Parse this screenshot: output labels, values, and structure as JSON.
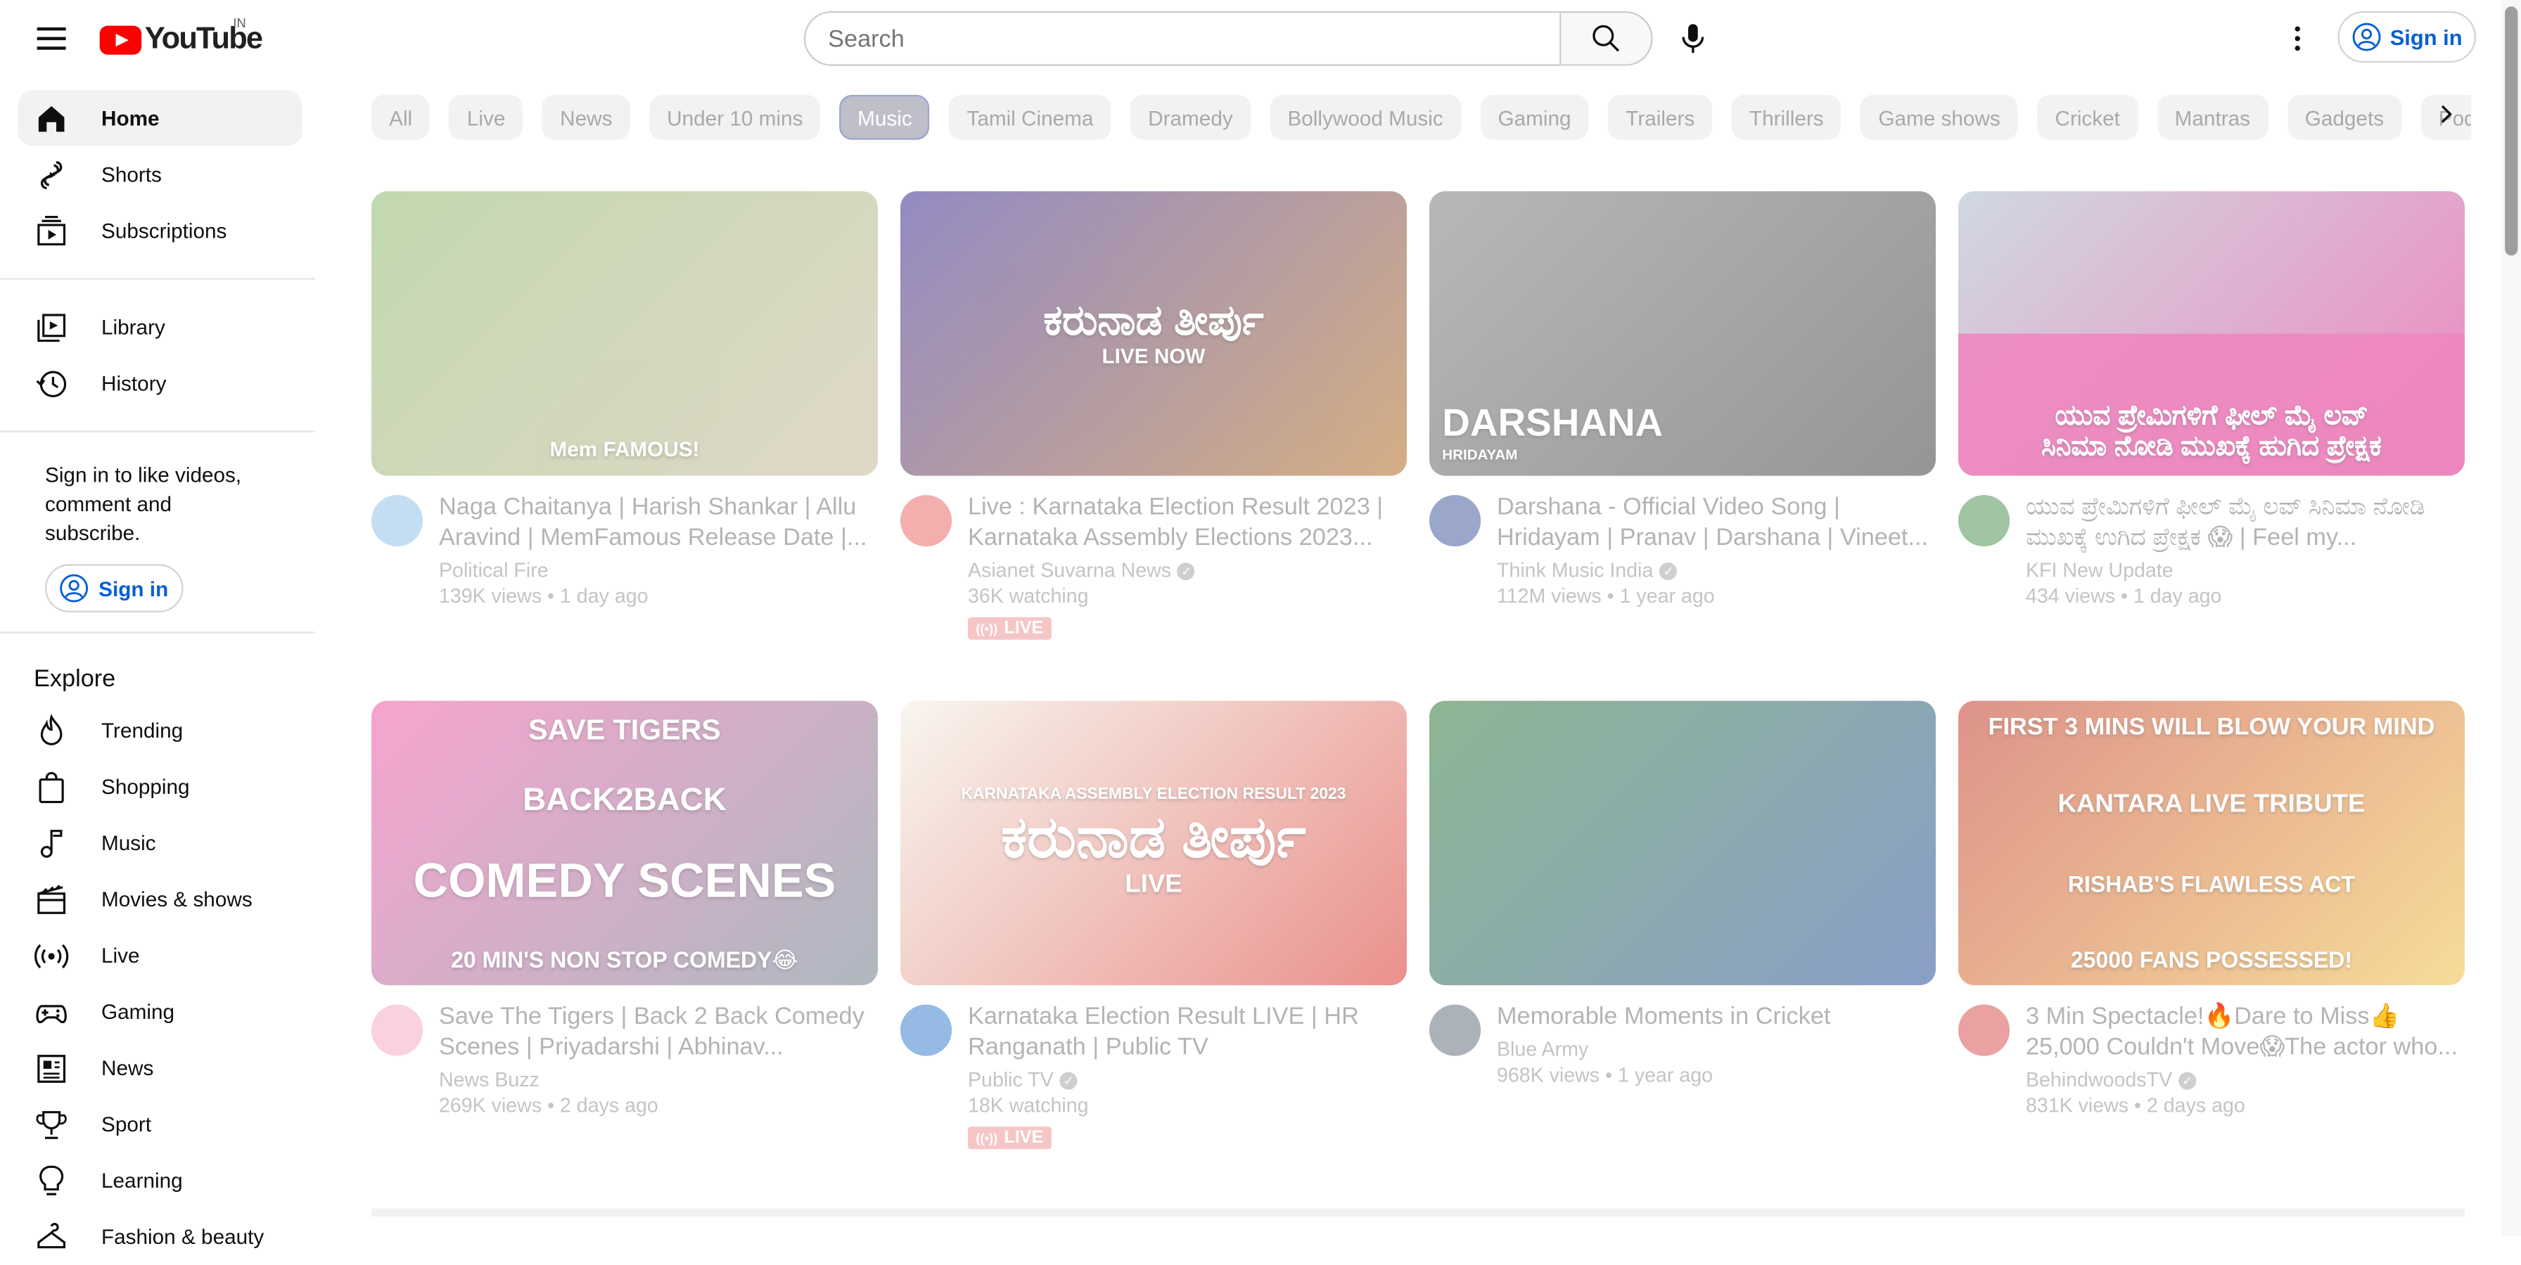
{
  "header": {
    "logo_text": "YouTube",
    "region": "IN",
    "search_placeholder": "Search",
    "signin_label": "Sign in"
  },
  "sidebar": {
    "primary": [
      {
        "label": "Home",
        "icon": "home-icon",
        "active": true
      },
      {
        "label": "Shorts",
        "icon": "shorts-icon"
      },
      {
        "label": "Subscriptions",
        "icon": "subscriptions-icon"
      }
    ],
    "secondary": [
      {
        "label": "Library",
        "icon": "library-icon"
      },
      {
        "label": "History",
        "icon": "history-icon"
      }
    ],
    "signin_prompt": "Sign in to like videos, comment and subscribe.",
    "signin_label": "Sign in",
    "explore_heading": "Explore",
    "explore": [
      {
        "label": "Trending",
        "icon": "trending-icon"
      },
      {
        "label": "Shopping",
        "icon": "shopping-icon"
      },
      {
        "label": "Music",
        "icon": "music-icon"
      },
      {
        "label": "Movies & shows",
        "icon": "movies-icon"
      },
      {
        "label": "Live",
        "icon": "live-icon"
      },
      {
        "label": "Gaming",
        "icon": "gaming-icon"
      },
      {
        "label": "News",
        "icon": "news-icon"
      },
      {
        "label": "Sport",
        "icon": "sport-icon"
      },
      {
        "label": "Learning",
        "icon": "learning-icon"
      },
      {
        "label": "Fashion & beauty",
        "icon": "fashion-icon"
      }
    ]
  },
  "chips": [
    "All",
    "Live",
    "News",
    "Under 10 mins",
    "Music",
    "Tamil Cinema",
    "Dramedy",
    "Bollywood Music",
    "Gaming",
    "Trailers",
    "Thrillers",
    "Game shows",
    "Cricket",
    "Mantras",
    "Gadgets",
    "Podcasts"
  ],
  "active_chip": "Music",
  "videos": [
    {
      "title": "Naga Chaitanya | Harish Shankar | Allu Aravind | MemFamous Release Date |...",
      "channel": "Political Fire",
      "verified": false,
      "stats": "139K views • 1 day ago",
      "live": false,
      "thumb_colors": [
        "#8fb86e",
        "#c7b79a"
      ],
      "avatar_color": "#7fb4e0"
    },
    {
      "title": "Live : Karnataka Election Result 2023 | Karnataka Assembly Elections 2023...",
      "channel": "Asianet Suvarna News",
      "verified": true,
      "stats": "36K watching",
      "live": true,
      "live_label": "LIVE",
      "thumb_colors": [
        "#3b2a8f",
        "#b06b1f"
      ],
      "avatar_color": "#e64b4b"
    },
    {
      "title": "Darshana - Official Video Song | Hridayam | Pranav | Darshana | Vineet...",
      "channel": "Think Music India",
      "verified": true,
      "stats": "112M views • 1 year ago",
      "live": false,
      "thumb_colors": [
        "#7d7d7d",
        "#3e3e3e"
      ],
      "avatar_color": "#1f3a8a"
    },
    {
      "title": "ಯುವ ಪ್ರೇಮಿಗಳಿಗೆ ಫೀಲ್ ಮೈ ಲವ್ ಸಿನಿಮಾ ನೋಡಿ ಮುಖಕ್ಕೆ ಉಗಿದ ಪ್ರೇಕ್ಷಕ 😱 | Feel my...",
      "channel": "KFI New Update",
      "verified": false,
      "stats": "434 views • 1 day ago",
      "live": false,
      "thumb_colors": [
        "#a9b9c8",
        "#e0258a"
      ],
      "avatar_color": "#2e7d32"
    },
    {
      "title": "Save The Tigers | Back 2 Back Comedy Scenes | Priyadarshi | Abhinav...",
      "channel": "News Buzz",
      "verified": false,
      "stats": "269K views • 2 days ago",
      "live": false,
      "thumb_colors": [
        "#f05aa8",
        "#6b7f8c"
      ],
      "avatar_color": "#f29bb5"
    },
    {
      "title": "Karnataka Election Result LIVE | HR Ranganath | Public TV",
      "channel": "Public TV",
      "verified": true,
      "stats": "18K watching",
      "live": true,
      "live_label": "LIVE",
      "thumb_colors": [
        "#f2efe2",
        "#d9362f"
      ],
      "avatar_color": "#1565c0"
    },
    {
      "title": "Memorable Moments in Cricket",
      "channel": "Blue Army",
      "verified": false,
      "stats": "968K views • 1 year ago",
      "live": false,
      "thumb_colors": [
        "#2f7a3a",
        "#2a4f9a"
      ],
      "avatar_color": "#445566"
    },
    {
      "title": "3 Min Spectacle!🔥Dare to Miss👍 25,000 Couldn't Move😱The actor who...",
      "channel": "BehindwoodsTV",
      "verified": true,
      "stats": "831K views • 2 days ago",
      "live": false,
      "thumb_colors": [
        "#c23a2a",
        "#f0c045"
      ],
      "avatar_color": "#d32f2f"
    }
  ],
  "thumb_texts": [
    [
      "Mem FAMOUS!"
    ],
    [
      "ಕರುನಾಡ ತೀರ್ಪು",
      "LIVE NOW"
    ],
    [
      "DARSHANA",
      "HRIDAYAM"
    ],
    [
      "ಯುವ ಪ್ರೇಮಿಗಳಿಗೆ ಫೀಲ್ ಮೈ ಲವ್",
      "ಸಿನಿಮಾ ನೋಡಿ ಮುಖಕ್ಕೆ ಹುಗಿದ ಪ್ರೇಕ್ಷಕ"
    ],
    [
      "SAVE TIGERS",
      "BACK2BACK",
      "COMEDY SCENES",
      "20 MIN'S NON STOP COMEDY😂"
    ],
    [
      "KARNATAKA ASSEMBLY ELECTION RESULT 2023",
      "ಕರುನಾಡ ತೀರ್ಪು",
      "LIVE"
    ],
    [],
    [
      "FIRST 3 MINS WILL BLOW YOUR MIND",
      "KANTARA LIVE TRIBUTE",
      "RISHAB'S FLAWLESS ACT",
      "25000 FANS POSSESSED!"
    ]
  ]
}
